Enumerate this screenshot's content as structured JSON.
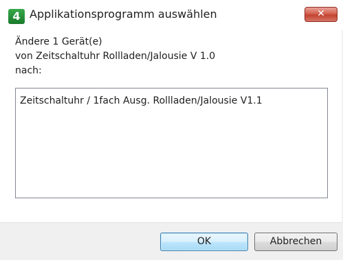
{
  "window": {
    "title": "Applikationsprogramm auswählen",
    "app_icon_glyph": "4",
    "app_icon_name": "app-logo-icon",
    "close_glyph": "✕",
    "close_icon_name": "close-icon"
  },
  "message": {
    "line1": "Ändere 1 Gerät(e)",
    "line2": "von Zeitschaltuhr Rollladen/Jalousie V 1.0",
    "line3": "nach:"
  },
  "list": {
    "items": [
      {
        "label": "Zeitschaltuhr / 1fach Ausg. Rollladen/Jalousie V1.1"
      }
    ]
  },
  "buttons": {
    "ok_label": "OK",
    "cancel_label": "Abbrechen"
  },
  "colors": {
    "close_button": "#c44331",
    "ok_button_border": "#3c7fb1",
    "footer_background": "#f0f0f0",
    "app_icon": "#1a7a2c"
  }
}
